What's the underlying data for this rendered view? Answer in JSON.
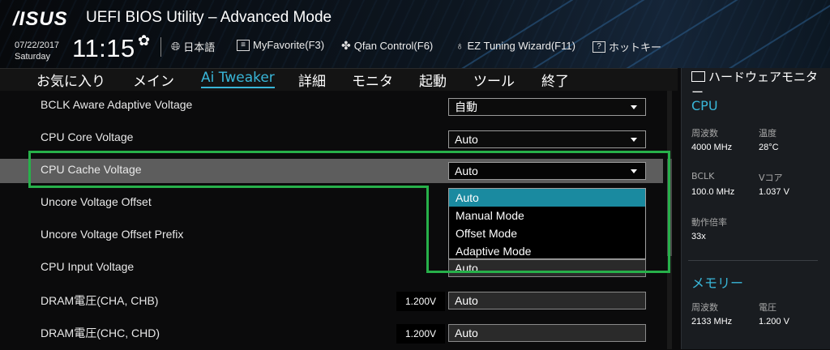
{
  "header": {
    "logo": "/ISUS",
    "title": "UEFI BIOS Utility – Advanced Mode",
    "date": "07/22/2017",
    "day": "Saturday",
    "time": "11:15",
    "items": [
      {
        "icon": "globe-icon",
        "label": "日本語"
      },
      {
        "icon": "favorite-icon",
        "label": "MyFavorite(F3)"
      },
      {
        "icon": "fan-icon",
        "label": "Qfan Control(F6)"
      },
      {
        "icon": "lightbulb-icon",
        "label": "EZ Tuning Wizard(F11)"
      },
      {
        "icon": "help-icon",
        "label": "ホットキー"
      }
    ]
  },
  "menu": {
    "tabs": [
      "お気に入り",
      "メイン",
      "Ai Tweaker",
      "詳細",
      "モニタ",
      "起動",
      "ツール",
      "終了"
    ],
    "active": "Ai Tweaker"
  },
  "settings": [
    {
      "label": "BCLK Aware Adaptive Voltage",
      "value": "自動"
    },
    {
      "label": "CPU Core Voltage",
      "value": "Auto"
    },
    {
      "label": "CPU Cache Voltage",
      "value": "Auto"
    },
    {
      "label": "Uncore Voltage Offset",
      "value": ""
    },
    {
      "label": "Uncore Voltage Offset Prefix",
      "value": ""
    },
    {
      "label": "CPU Input Voltage",
      "value": "Auto"
    },
    {
      "label": "DRAM電圧(CHA, CHB)",
      "reading": "1.200V",
      "value": "Auto"
    },
    {
      "label": "DRAM電圧(CHC, CHD)",
      "reading": "1.200V",
      "value": "Auto"
    }
  ],
  "dropdown": {
    "options": [
      "Auto",
      "Manual Mode",
      "Offset Mode",
      "Adaptive Mode"
    ],
    "highlighted": "Auto"
  },
  "monitor": {
    "title": "ハードウェアモニター",
    "cpu": {
      "heading": "CPU",
      "freq_label": "周波数",
      "freq_value": "4000 MHz",
      "temp_label": "温度",
      "temp_value": "28°C",
      "bclk_label": "BCLK",
      "bclk_value": "100.0 MHz",
      "vcore_label": "Vコア",
      "vcore_value": "1.037 V",
      "ratio_label": "動作倍率",
      "ratio_value": "33x"
    },
    "memory": {
      "heading": "メモリー",
      "freq_label": "周波数",
      "freq_value": "2133 MHz",
      "volt_label": "電圧",
      "volt_value": "1.200 V"
    }
  },
  "colors": {
    "accent": "#39b6d8",
    "selected_row": "#5d5d5d",
    "highlight_option": "#1a8aa0",
    "annotation_box": "#27b04a"
  }
}
